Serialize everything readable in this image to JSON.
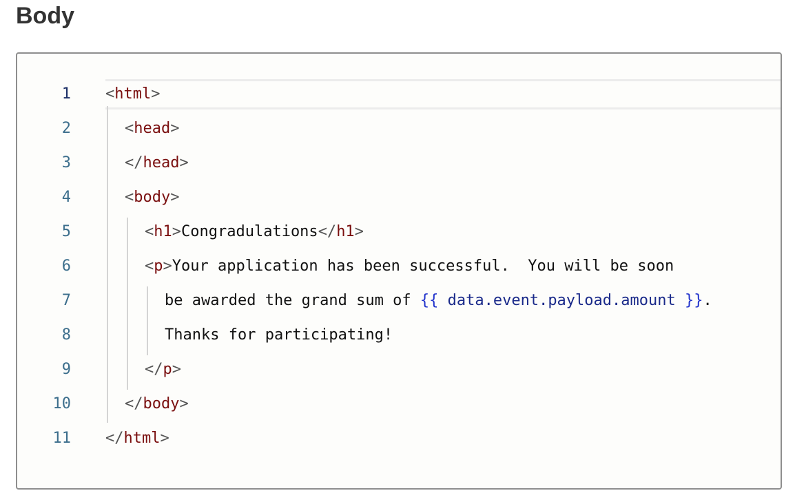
{
  "section": {
    "title": "Body"
  },
  "editor": {
    "active_line": 1,
    "lines": [
      {
        "number": "1",
        "tokens": [
          {
            "t": "<",
            "k": "bracket"
          },
          {
            "t": "html",
            "k": "tag"
          },
          {
            "t": ">",
            "k": "bracket"
          }
        ]
      },
      {
        "number": "2",
        "tokens": [
          {
            "t": "<",
            "k": "bracket"
          },
          {
            "t": "head",
            "k": "tag"
          },
          {
            "t": ">",
            "k": "bracket"
          }
        ]
      },
      {
        "number": "3",
        "tokens": [
          {
            "t": "</",
            "k": "bracket"
          },
          {
            "t": "head",
            "k": "tag"
          },
          {
            "t": ">",
            "k": "bracket"
          }
        ]
      },
      {
        "number": "4",
        "tokens": [
          {
            "t": "<",
            "k": "bracket"
          },
          {
            "t": "body",
            "k": "tag"
          },
          {
            "t": ">",
            "k": "bracket"
          }
        ]
      },
      {
        "number": "5",
        "tokens": [
          {
            "t": "<",
            "k": "bracket"
          },
          {
            "t": "h1",
            "k": "tag"
          },
          {
            "t": ">",
            "k": "bracket"
          },
          {
            "t": "Congradulations",
            "k": "text"
          },
          {
            "t": "</",
            "k": "bracket"
          },
          {
            "t": "h1",
            "k": "tag"
          },
          {
            "t": ">",
            "k": "bracket"
          }
        ]
      },
      {
        "number": "6",
        "tokens": [
          {
            "t": "<",
            "k": "bracket"
          },
          {
            "t": "p",
            "k": "tag"
          },
          {
            "t": ">",
            "k": "bracket"
          },
          {
            "t": "Your application has been successful.  You will be soon",
            "k": "text"
          }
        ]
      },
      {
        "number": "7",
        "tokens": [
          {
            "t": "be awarded the grand sum of ",
            "k": "text"
          },
          {
            "t": "{{",
            "k": "tpl"
          },
          {
            "t": " data.event.payload.amount ",
            "k": "tpl-path"
          },
          {
            "t": "}}",
            "k": "tpl"
          },
          {
            "t": ".",
            "k": "text"
          }
        ]
      },
      {
        "number": "8",
        "tokens": [
          {
            "t": "Thanks for participating!",
            "k": "text"
          }
        ]
      },
      {
        "number": "9",
        "tokens": [
          {
            "t": "</",
            "k": "bracket"
          },
          {
            "t": "p",
            "k": "tag"
          },
          {
            "t": ">",
            "k": "bracket"
          }
        ]
      },
      {
        "number": "10",
        "tokens": [
          {
            "t": "</",
            "k": "bracket"
          },
          {
            "t": "body",
            "k": "tag"
          },
          {
            "t": ">",
            "k": "bracket"
          }
        ]
      },
      {
        "number": "11",
        "tokens": [
          {
            "t": "</",
            "k": "bracket"
          },
          {
            "t": "html",
            "k": "tag"
          },
          {
            "t": ">",
            "k": "bracket"
          }
        ]
      }
    ]
  },
  "colors": {
    "tag": "#7a0f0f",
    "template": "#2233cc",
    "line_number": "#3c6e8c",
    "border": "#8e8e8e"
  }
}
